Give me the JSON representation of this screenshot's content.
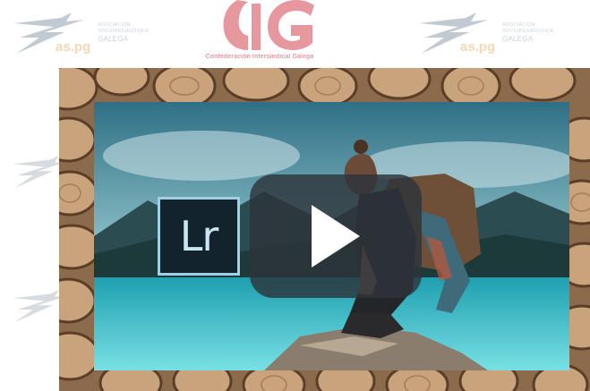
{
  "watermark": {
    "brand_pg": "as.pg",
    "org_line_1": "ASOCIACIÓN",
    "org_line_2": "SOCIOPEDAGÓXICA",
    "org_line_3": "GALEGA"
  },
  "header_logo": {
    "caption": "Confederación Intersindical Galega"
  },
  "video": {
    "app_badge": "Lr",
    "icons": {
      "play": "play-icon",
      "app": "lightroom-icon"
    },
    "colors": {
      "play_bg": "#2d343a",
      "badge_bg": "#13232e",
      "badge_border": "#9fd0e4"
    }
  }
}
